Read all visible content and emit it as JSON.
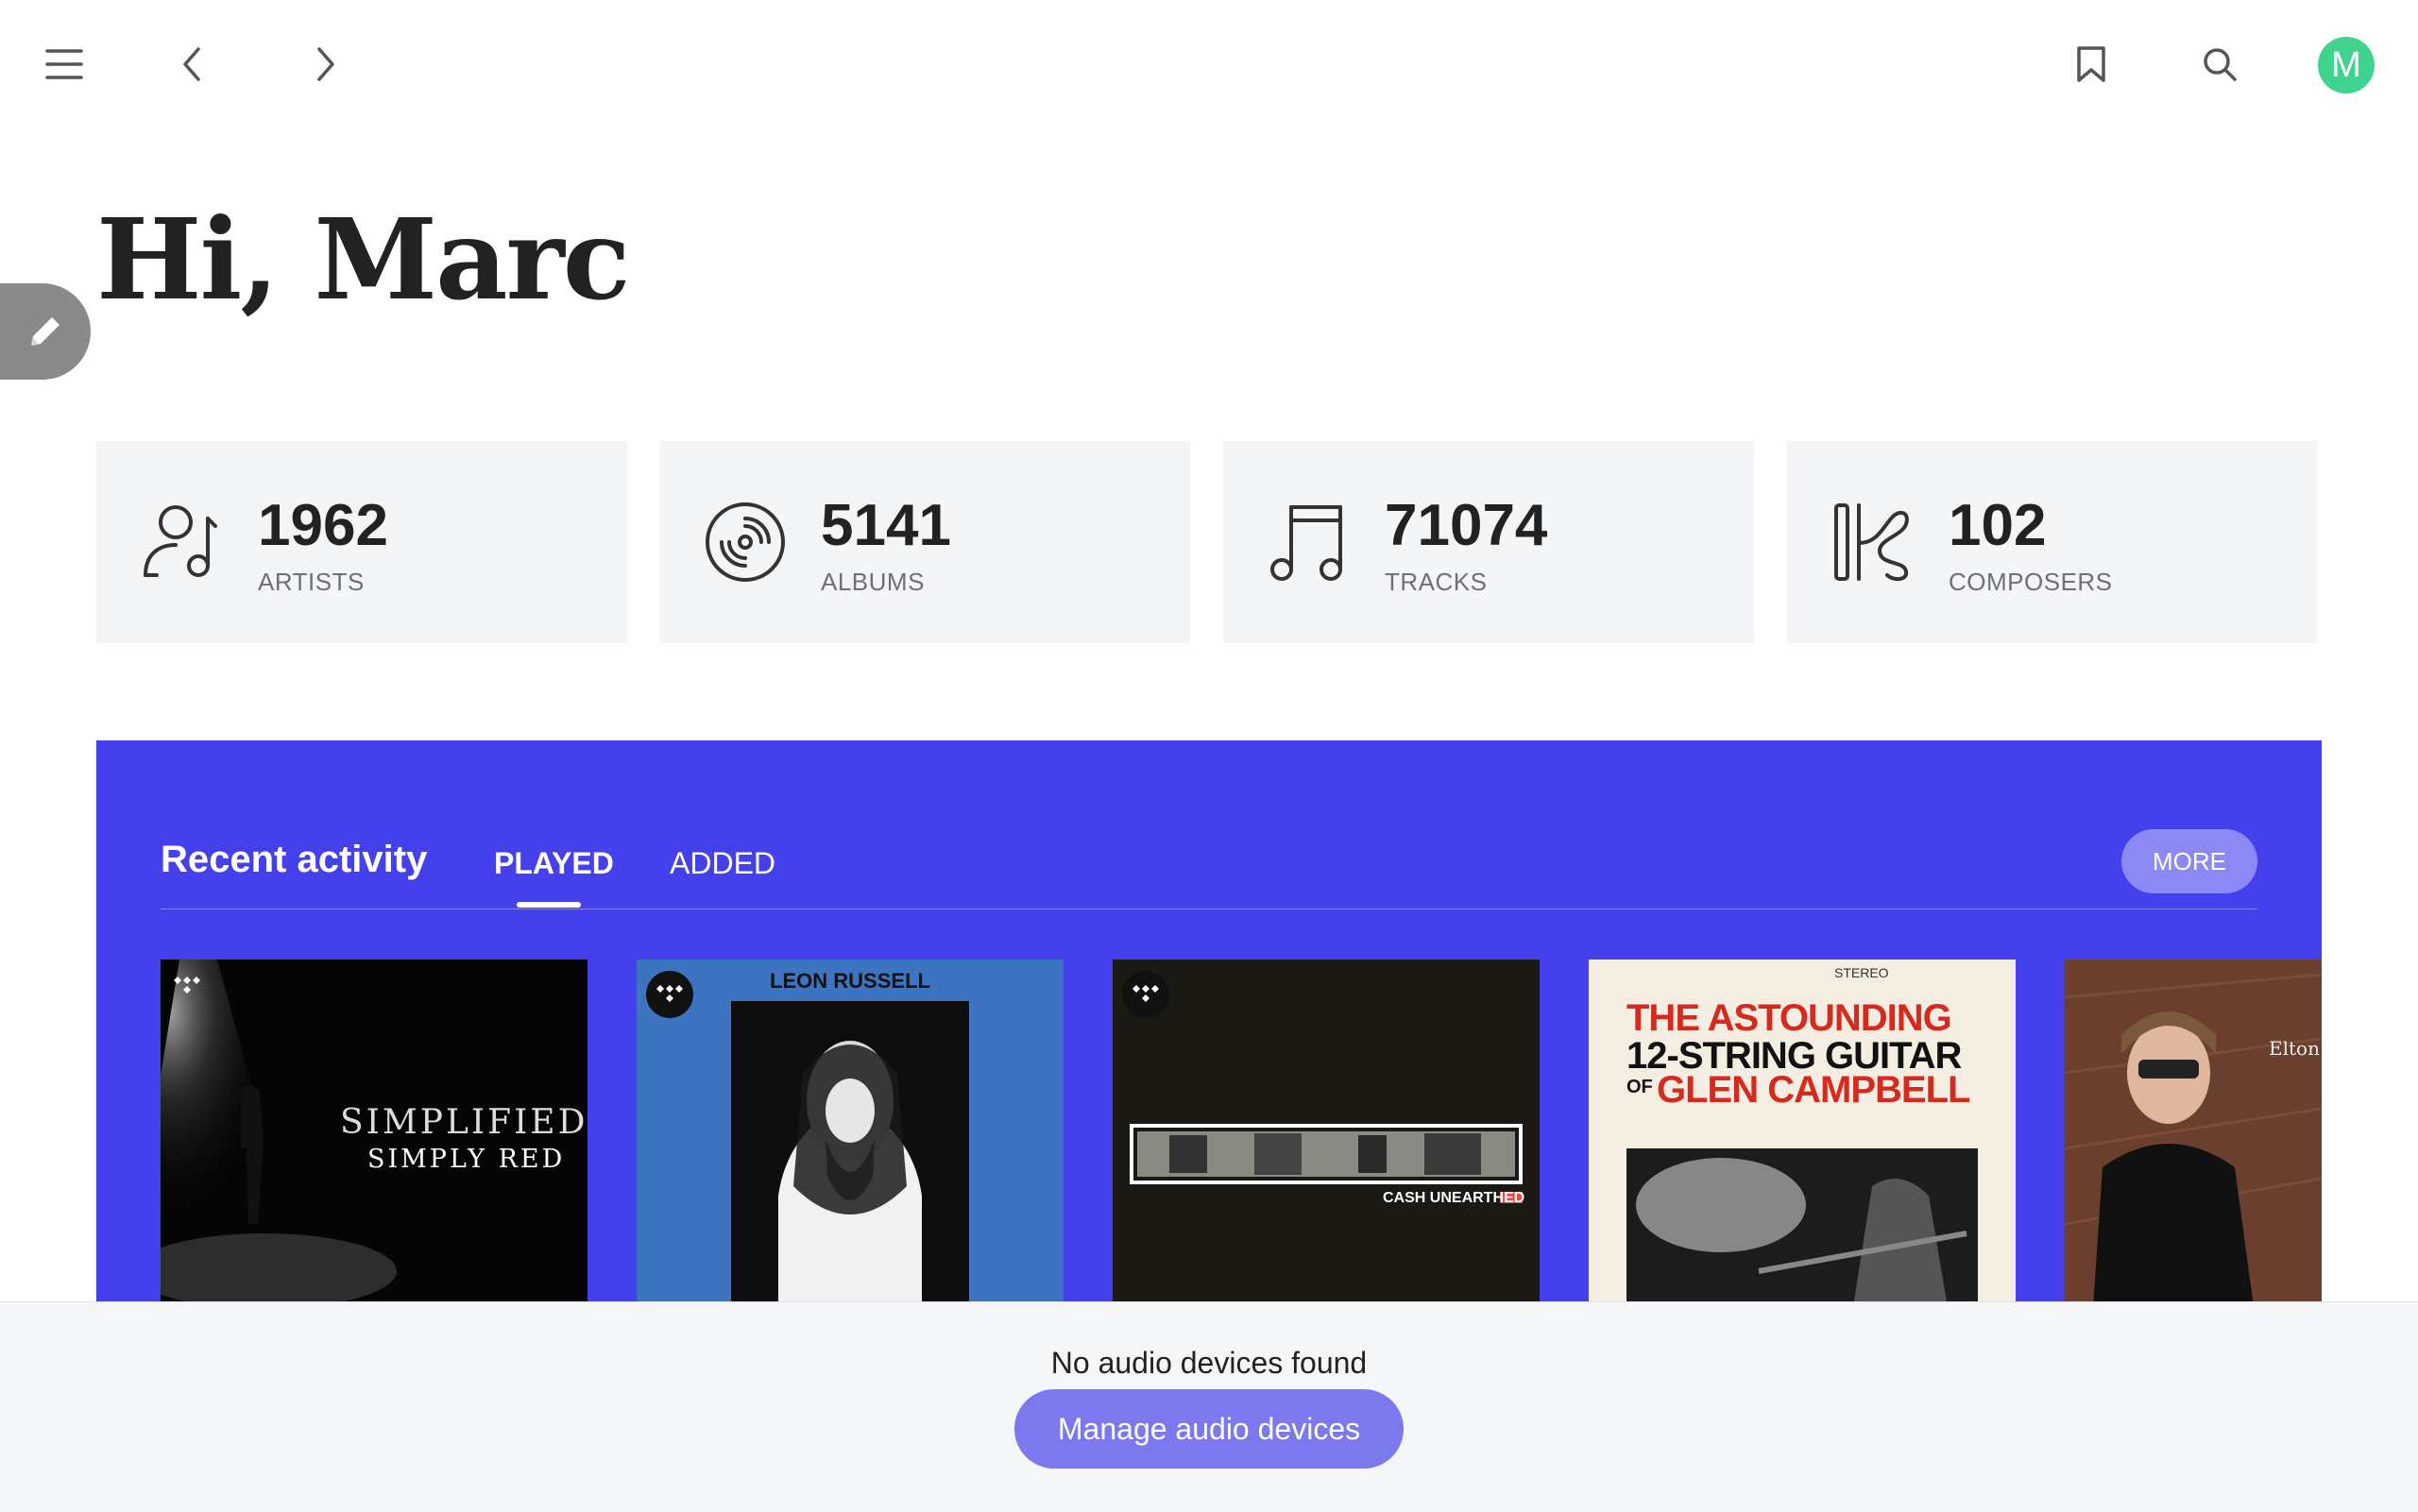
{
  "greeting": "Hi, Marc",
  "user": {
    "initial": "M",
    "avatar_color": "#3fd38f"
  },
  "stats": [
    {
      "value": "1962",
      "label": "ARTISTS",
      "icon": "artist-icon"
    },
    {
      "value": "5141",
      "label": "ALBUMS",
      "icon": "album-disc-icon"
    },
    {
      "value": "71074",
      "label": "TRACKS",
      "icon": "music-note-icon"
    },
    {
      "value": "102",
      "label": "COMPOSERS",
      "icon": "composer-icon"
    }
  ],
  "recent": {
    "title": "Recent activity",
    "tabs": [
      {
        "label": "PLAYED",
        "active": true
      },
      {
        "label": "ADDED",
        "active": false
      }
    ],
    "more_label": "MORE",
    "background": "#4440ec",
    "albums": [
      {
        "name": "simplified-simply-red",
        "cover_line1": "SIMPLIFIED",
        "cover_line2": "SIMPLY RED",
        "tidal": true
      },
      {
        "name": "leon-russell",
        "cover_line1": "LEON RUSSELL",
        "tidal": true
      },
      {
        "name": "cash-unearthed",
        "cover_line1": "CASH UNEARTHED",
        "tidal": true
      },
      {
        "name": "glen-campbell",
        "cover_top": "STEREO",
        "cover_line1": "THE ASTOUNDING",
        "cover_line2": "12-STRING GUITAR",
        "cover_line3": "OF",
        "cover_line4": "GLEN CAMPBELL",
        "tidal": false
      },
      {
        "name": "elton",
        "cover_line1": "Elton",
        "tidal": false
      }
    ]
  },
  "footer": {
    "message": "No audio devices found",
    "button": "Manage audio devices"
  }
}
